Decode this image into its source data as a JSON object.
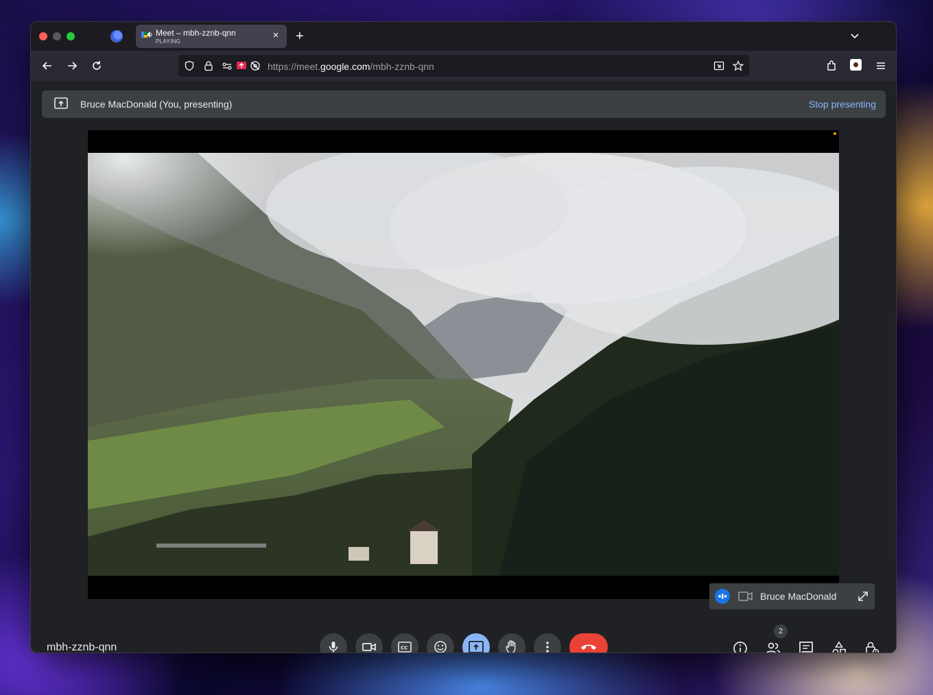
{
  "browser": {
    "tab": {
      "title": "Meet – mbh-zznb-qnn",
      "status": "PLAYING"
    },
    "url": {
      "prefix": "https://meet.",
      "domain": "google.com",
      "path": "/mbh-zznb-qnn"
    }
  },
  "presenting": {
    "text": "Bruce MacDonald (You, presenting)",
    "stop_label": "Stop presenting"
  },
  "self_tile": {
    "name": "Bruce MacDonald"
  },
  "meeting": {
    "code": "mbh-zznb-qnn",
    "participant_count": "2"
  },
  "colors": {
    "end_call": "#ea4335",
    "accent": "#8ab4f8",
    "speaking": "#1a73e8"
  },
  "icons": [
    "microphone-icon",
    "camera-icon",
    "captions-icon",
    "emoji-icon",
    "present-icon",
    "raise-hand-icon",
    "more-options-icon",
    "end-call-icon",
    "info-icon",
    "people-icon",
    "chat-icon",
    "activities-icon",
    "host-controls-icon"
  ]
}
